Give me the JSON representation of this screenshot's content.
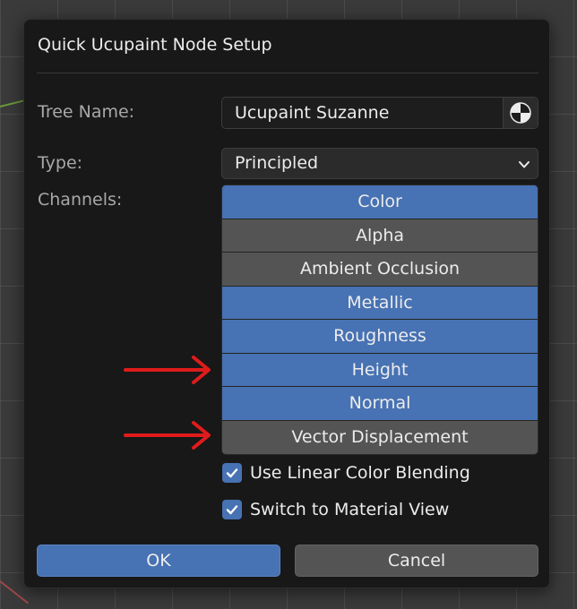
{
  "dialog": {
    "title": "Quick Ucupaint Node Setup",
    "tree_name": {
      "label": "Tree Name:",
      "value": "Ucupaint Suzanne",
      "icon": "shading-sphere-icon"
    },
    "type": {
      "label": "Type:",
      "value": "Principled",
      "icon": "chevron-down-icon"
    },
    "channels": {
      "label": "Channels:",
      "items": [
        {
          "label": "Color",
          "enabled": true
        },
        {
          "label": "Alpha",
          "enabled": false
        },
        {
          "label": "Ambient Occlusion",
          "enabled": false
        },
        {
          "label": "Metallic",
          "enabled": true
        },
        {
          "label": "Roughness",
          "enabled": true
        },
        {
          "label": "Height",
          "enabled": true
        },
        {
          "label": "Normal",
          "enabled": true
        },
        {
          "label": "Vector Displacement",
          "enabled": false
        }
      ]
    },
    "options": [
      {
        "label": "Use Linear Color Blending",
        "checked": true
      },
      {
        "label": "Switch to Material View",
        "checked": true
      }
    ],
    "buttons": {
      "ok": "OK",
      "cancel": "Cancel"
    }
  },
  "annotations": {
    "arrow_color": "#e01b1b",
    "arrow_targets": [
      "Height",
      "Vector Displacement"
    ]
  },
  "colors": {
    "accent": "#4772b3",
    "button_off": "#545454",
    "dialog_bg": "#181818"
  }
}
